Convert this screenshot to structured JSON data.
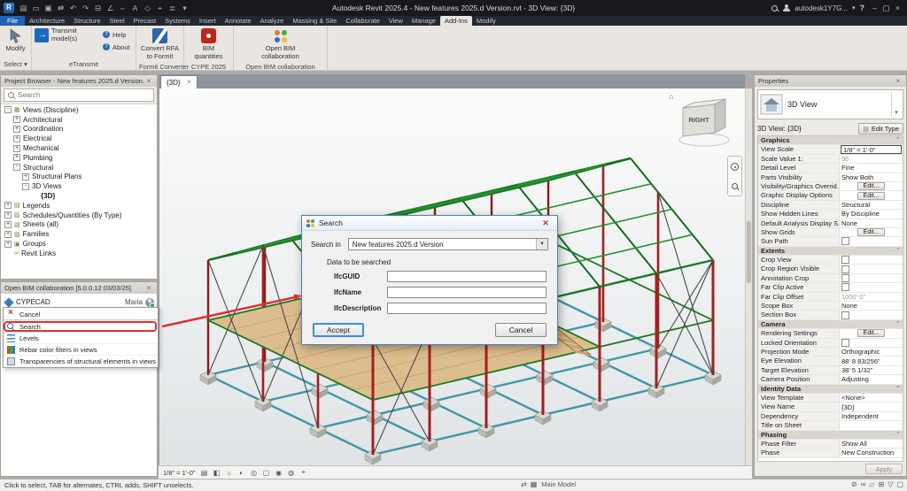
{
  "title_bar": {
    "app_title": "Autodesk Revit 2025.4 - New features 2025.d Version.rvt - 3D View: {3D}",
    "account": "autodesk1Y7G...",
    "help": "?",
    "quick_access": [
      {
        "n": "file-menu-icon",
        "g": "▤"
      },
      {
        "n": "open-icon",
        "g": "▭"
      },
      {
        "n": "save-icon",
        "g": "▣"
      },
      {
        "n": "sync-icon",
        "g": "⇄"
      },
      {
        "n": "undo-icon",
        "g": "↶"
      },
      {
        "n": "redo-icon",
        "g": "↷"
      },
      {
        "n": "print-icon",
        "g": "⊟"
      },
      {
        "n": "measure-icon",
        "g": "∠"
      },
      {
        "n": "dimension-icon",
        "g": "⇔"
      },
      {
        "n": "text-icon",
        "g": "A"
      },
      {
        "n": "default-3d-view-icon",
        "g": "◇"
      },
      {
        "n": "section-icon",
        "g": "⌖"
      },
      {
        "n": "thin-lines-icon",
        "g": "≣"
      },
      {
        "n": "qat-dropdown-icon",
        "g": "▾"
      }
    ],
    "window_controls": [
      {
        "n": "minimize-button",
        "g": "–"
      },
      {
        "n": "restore-button",
        "g": "▢"
      },
      {
        "n": "close-button",
        "g": "×"
      }
    ]
  },
  "ribbon": {
    "tabs": [
      {
        "label": "File",
        "cls": "t-file"
      },
      {
        "label": "Architecture"
      },
      {
        "label": "Structure"
      },
      {
        "label": "Steel"
      },
      {
        "label": "Precast"
      },
      {
        "label": "Systems"
      },
      {
        "label": "Insert"
      },
      {
        "label": "Annotate"
      },
      {
        "label": "Analyze"
      },
      {
        "label": "Massing & Site"
      },
      {
        "label": "Collaborate"
      },
      {
        "label": "View"
      },
      {
        "label": "Manage"
      },
      {
        "label": "Add-Ins",
        "cls": "t-active"
      },
      {
        "label": "Modify"
      }
    ],
    "groups": {
      "select": {
        "button": "Modify",
        "label": "Select ▾"
      },
      "etransmit": {
        "button": "Transmit model(s)",
        "label": "eTransmit",
        "help": "Help",
        "about": "About"
      },
      "formit": {
        "button": "Convert RFA to Formit",
        "label": "Formit Converter"
      },
      "cype": {
        "button": "BIM quantities",
        "label": "CYPE 2025"
      },
      "openbim": {
        "button": "Open BIM collaboration",
        "label": "Open BIM collaboration"
      }
    }
  },
  "project_browser": {
    "title": "Project Browser - New features 2025.d Version.rvt",
    "search_placeholder": "Search",
    "tree": [
      {
        "cls": "lvl0",
        "exp": "-",
        "icon": "▦",
        "label": "Views (Discipline)"
      },
      {
        "cls": "lvl1",
        "exp": "+",
        "label": "Architectural"
      },
      {
        "cls": "lvl1",
        "exp": "+",
        "label": "Coordination"
      },
      {
        "cls": "lvl1",
        "exp": "+",
        "label": "Electrical"
      },
      {
        "cls": "lvl1",
        "exp": "+",
        "label": "Mechanical"
      },
      {
        "cls": "lvl1",
        "exp": "+",
        "label": "Plumbing"
      },
      {
        "cls": "lvl1",
        "exp": "-",
        "label": "Structural"
      },
      {
        "cls": "lvl2",
        "exp": "+",
        "label": "Structural Plans"
      },
      {
        "cls": "lvl2",
        "exp": "-",
        "label": "3D Views"
      },
      {
        "cls": "lvl3 sel",
        "exp": "",
        "label": "{3D}"
      },
      {
        "cls": "lvl0",
        "exp": "+",
        "icon": "▤",
        "label": "Legends"
      },
      {
        "cls": "lvl0",
        "exp": "+",
        "icon": "▥",
        "label": "Schedules/Quantities (By Type)"
      },
      {
        "cls": "lvl0",
        "exp": "+",
        "icon": "▧",
        "label": "Sheets (all)"
      },
      {
        "cls": "lvl0",
        "exp": "+",
        "icon": "▨",
        "label": "Families"
      },
      {
        "cls": "lvl0",
        "exp": "+",
        "icon": "▣",
        "label": "Groups"
      },
      {
        "cls": "lvl0",
        "exp": "",
        "icon": "∞",
        "label": "Revit Links"
      }
    ]
  },
  "collab": {
    "title": "Open BIM collaboration [5.0.0.12 03/03/25]",
    "project": "CYPECAD",
    "user": "Maria",
    "toolbar": [
      {
        "n": "import-icon",
        "g": "⇓"
      },
      {
        "n": "export-icon",
        "g": "⇑"
      },
      {
        "n": "update-icon",
        "g": "⇄"
      },
      {
        "n": "settings-icon",
        "g": "≣"
      }
    ],
    "menu": [
      {
        "label": "Cancel",
        "icon": "cancel-icon",
        "cls": "ic-cancel sep"
      },
      {
        "label": "Search",
        "icon": "search-icon",
        "cls": "ic-search hl"
      },
      {
        "label": "Levels",
        "icon": "levels-icon",
        "cls": "ic-levels"
      },
      {
        "label": "Rebar color filters in views",
        "icon": "rebar-filters-icon",
        "cls": "ic-rebar"
      },
      {
        "label": "Transparencies of structural elements in views",
        "icon": "transparency-icon",
        "cls": "ic-transp"
      }
    ]
  },
  "viewport": {
    "tab": "{3D}",
    "viewcube_face": "RIGHT"
  },
  "view_controls": {
    "scale": "1/8\" = 1'-0\"",
    "icons": [
      {
        "n": "detail-level-icon",
        "g": "▤"
      },
      {
        "n": "visual-style-icon",
        "g": "◧"
      },
      {
        "n": "sun-path-icon",
        "g": "☼"
      },
      {
        "n": "shadows-icon",
        "g": "◐"
      },
      {
        "n": "rendering-icon",
        "g": "◎"
      },
      {
        "n": "crop-region-icon",
        "g": "▢"
      },
      {
        "n": "reveal-hidden-icon",
        "g": "◉"
      },
      {
        "n": "temporary-hide-isolate-icon",
        "g": "◍"
      },
      {
        "n": "analytical-model-icon",
        "g": "⌖"
      }
    ]
  },
  "search_dialog": {
    "title": "Search",
    "search_in_label": "Search in",
    "search_in_value": "New features 2025.d Version",
    "section_label": "Data to be searched",
    "fields": [
      {
        "label": "IfcGUID",
        "value": ""
      },
      {
        "label": "IfcName",
        "value": ""
      },
      {
        "label": "IfcDescription",
        "value": ""
      }
    ],
    "accept_label": "Accept",
    "cancel_label": "Cancel"
  },
  "properties": {
    "title": "Properties",
    "type_name": "3D View",
    "instance_label": "3D View: {3D}",
    "edit_type_label": "Edit Type",
    "apply_label": "Apply",
    "rows": [
      {
        "label": "Graphics",
        "cls": "section"
      },
      {
        "label": "View Scale",
        "value": "1/8\" = 1'-0\"",
        "cls": "scalebox"
      },
      {
        "label": "Scale Value 1:",
        "value": "96",
        "cls": "dim"
      },
      {
        "label": "Detail Level",
        "value": "Fine"
      },
      {
        "label": "Parts Visibility",
        "value": "Show Both"
      },
      {
        "label": "Visibility/Graphics Overrid...",
        "value": "Edit...",
        "cls": "btn"
      },
      {
        "label": "Graphic Display Options",
        "value": "Edit...",
        "cls": "btn"
      },
      {
        "label": "Discipline",
        "value": "Structural"
      },
      {
        "label": "Show Hidden Lines",
        "value": "By Discipline"
      },
      {
        "label": "Default Analysis Display S...",
        "value": "None"
      },
      {
        "label": "Show Grids",
        "value": "Edit...",
        "cls": "btn"
      },
      {
        "label": "Sun Path",
        "cls": "check"
      },
      {
        "label": "Extents",
        "cls": "section"
      },
      {
        "label": "Crop View",
        "cls": "check"
      },
      {
        "label": "Crop Region Visible",
        "cls": "check"
      },
      {
        "label": "Annotation Crop",
        "cls": "check"
      },
      {
        "label": "Far Clip Active",
        "cls": "check"
      },
      {
        "label": "Far Clip Offset",
        "value": "1000'  0\"",
        "cls": "dim"
      },
      {
        "label": "Scope Box",
        "value": "None"
      },
      {
        "label": "Section Box",
        "cls": "check"
      },
      {
        "label": "Camera",
        "cls": "section"
      },
      {
        "label": "Rendering Settings",
        "value": "Edit...",
        "cls": "btn"
      },
      {
        "label": "Locked Orientation",
        "cls": "check"
      },
      {
        "label": "Projection Mode",
        "value": "Orthographic"
      },
      {
        "label": "Eye Elevation",
        "value": "88'  8 83/256\""
      },
      {
        "label": "Target Elevation",
        "value": "38'  5 1/32\""
      },
      {
        "label": "Camera Position",
        "value": "Adjusting"
      },
      {
        "label": "Identity Data",
        "cls": "section"
      },
      {
        "label": "View Template",
        "value": "<None>"
      },
      {
        "label": "View Name",
        "value": "{3D}"
      },
      {
        "label": "Dependency",
        "value": "Independent"
      },
      {
        "label": "Title on Sheet",
        "value": ""
      },
      {
        "label": "Phasing",
        "cls": "section"
      },
      {
        "label": "Phase Filter",
        "value": "Show All"
      },
      {
        "label": "Phase",
        "value": "New Construction"
      }
    ]
  },
  "status_bar": {
    "hint": "Click to select, TAB for alternates, CTRL adds, SHIFT unselects.",
    "workset_label": "Main Model",
    "left_icons": [
      {
        "n": "worksharing-icon",
        "g": "⇄"
      },
      {
        "n": "worksets-icon",
        "g": "▦"
      }
    ],
    "right_icons": [
      {
        "n": "editable-only-icon",
        "g": "⊘"
      },
      {
        "n": "select-links-icon",
        "g": "∞"
      },
      {
        "n": "select-underlay-icon",
        "g": "▱"
      },
      {
        "n": "drag-elements-icon",
        "g": "⊞"
      },
      {
        "n": "filter-icon",
        "g": "▽"
      },
      {
        "n": "selection-toggle-icon",
        "g": "▢"
      }
    ]
  }
}
